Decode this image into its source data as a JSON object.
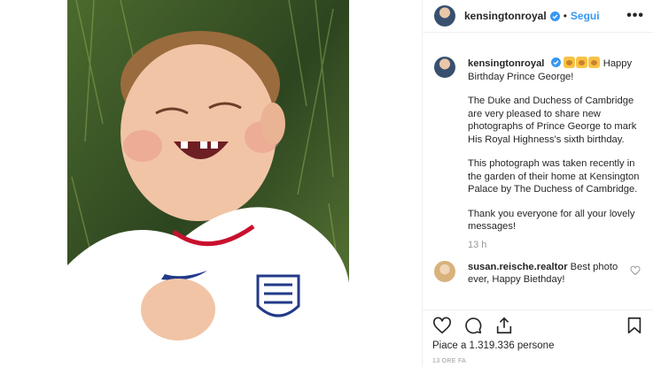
{
  "post": {
    "username": "kensingtonroyal",
    "follow_label": "Segui",
    "separator": "•",
    "more_label": "•••",
    "caption": {
      "emojis": [
        "lion-emoji",
        "lion-emoji",
        "lion-emoji"
      ],
      "line1": "Happy Birthday Prince George!",
      "para2": "The Duke and Duchess of Cambridge are very pleased to share new photographs of Prince George to mark His Royal Highness's sixth birthday.",
      "para3": "This photograph was taken recently in the garden of their home at Kensington Palace by The Duchess of Cambridge.",
      "para4": "Thank you everyone for all your lovely messages!"
    },
    "caption_time": "13 h",
    "comments": [
      {
        "username": "susan.reische.realtor",
        "text": "Best photo ever, Happy Biethday!"
      }
    ],
    "likes_text": "Piace a 1.319.336 persone",
    "timestamp": "13 ORE FA"
  },
  "icons": {
    "like": "heart-icon",
    "comment": "comment-icon",
    "share": "share-icon",
    "save": "bookmark-icon",
    "verified": "verified-badge-icon"
  },
  "colors": {
    "accent": "#3897f0",
    "text": "#262626",
    "muted": "#999999"
  }
}
